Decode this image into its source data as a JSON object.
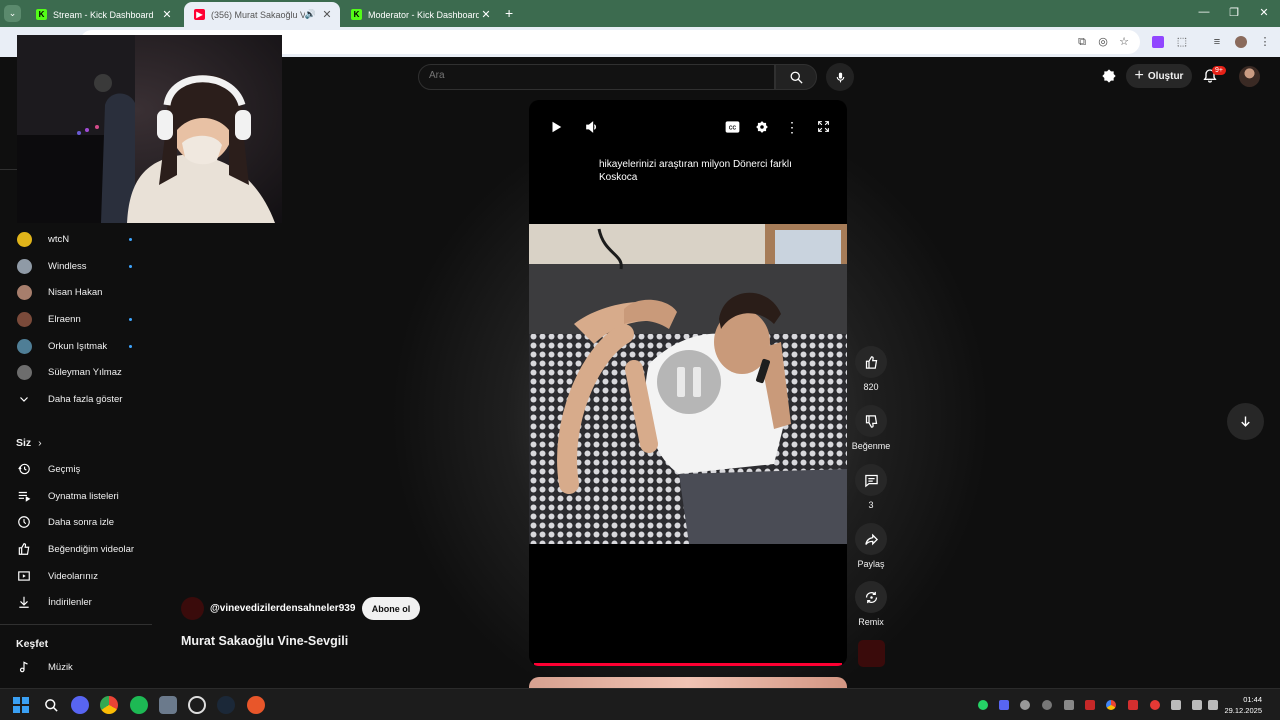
{
  "browser": {
    "tabs": [
      {
        "title": "Stream - Kick Dashboard",
        "favicon": "kick-icon"
      },
      {
        "title": "(356) Murat Sakaoğlu Vine",
        "favicon": "youtube-icon",
        "active": true
      },
      {
        "title": "Moderator - Kick Dashboard",
        "favicon": "kick-icon"
      }
    ],
    "new_tab": "+",
    "window_controls": [
      "—",
      "❐",
      "✕"
    ]
  },
  "youtube": {
    "search_placeholder": "Ara",
    "create_label": "Oluştur",
    "notif_badge": "9+"
  },
  "sidebar": {
    "subscriptions": [
      {
        "name": "wtcN",
        "new": true,
        "color": "#e0b41a"
      },
      {
        "name": "Windless",
        "new": true,
        "color": "#8f9aa6"
      },
      {
        "name": "Nisan Hakan",
        "new": false,
        "color": "#a77e6c"
      },
      {
        "name": "Elraenn",
        "new": true,
        "color": "#7a4a3a"
      },
      {
        "name": "Orkun Işıtmak",
        "new": true,
        "color": "#4f7e96"
      },
      {
        "name": "Süleyman Yılmaz",
        "new": false,
        "color": "#6d6d6d"
      }
    ],
    "show_more": "Daha fazla göster",
    "you_header": "Siz",
    "you_items": [
      {
        "label": "Geçmiş",
        "icon": "history-icon"
      },
      {
        "label": "Oynatma listeleri",
        "icon": "playlist-icon"
      },
      {
        "label": "Daha sonra izle",
        "icon": "watch-later-icon"
      },
      {
        "label": "Beğendiğim videolar",
        "icon": "liked-icon"
      },
      {
        "label": "Videolarınız",
        "icon": "your-videos-icon"
      },
      {
        "label": "İndirilenler",
        "icon": "downloads-icon"
      }
    ],
    "explore_header": "Keşfet",
    "explore_items": [
      {
        "label": "Müzik",
        "icon": "music-icon"
      }
    ]
  },
  "short": {
    "caption": "hikayelerinizi araştıran milyon Dönerci farklı Koskoca",
    "channel": "@vinevedizilerdensahneler939",
    "subscribe": "Abone ol",
    "title": "Murat Sakaoğlu Vine-Sevgili",
    "likes": "820",
    "dislike_label": "Beğenme",
    "comments": "3",
    "share_label": "Paylaş",
    "remix_label": "Remix",
    "progress": 1.0
  },
  "clock": {
    "time": "01:44",
    "date": "29.12.2025"
  },
  "colors": {
    "accent": "#ff0033",
    "kick": "#53fc18",
    "chrome_tabbar": "#3c6b4f"
  }
}
